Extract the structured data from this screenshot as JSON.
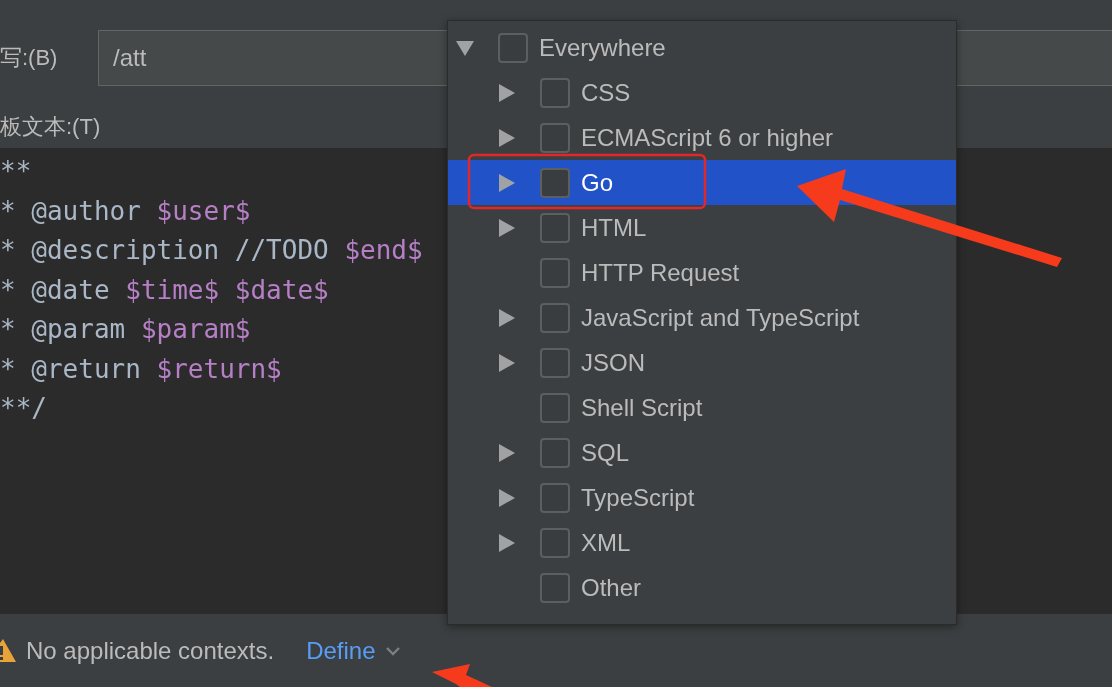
{
  "abbreviation": {
    "label": "写:(B)",
    "value": "/att"
  },
  "template_text": {
    "label": "板文本:(T)",
    "lines": [
      [
        {
          "text": "**",
          "kind": "plain"
        }
      ],
      [
        {
          "text": "* @author ",
          "kind": "plain"
        },
        {
          "text": "$user$",
          "kind": "variable"
        }
      ],
      [
        {
          "text": "* @description //TODO ",
          "kind": "plain"
        },
        {
          "text": "$end$",
          "kind": "variable"
        }
      ],
      [
        {
          "text": "* @date ",
          "kind": "plain"
        },
        {
          "text": "$time$ $date$",
          "kind": "variable"
        }
      ],
      [
        {
          "text": "* @param ",
          "kind": "plain"
        },
        {
          "text": "$param$",
          "kind": "variable"
        }
      ],
      [
        {
          "text": "* @return ",
          "kind": "plain"
        },
        {
          "text": "$return$",
          "kind": "variable"
        }
      ],
      [
        {
          "text": "**/",
          "kind": "plain"
        }
      ]
    ]
  },
  "context_popup": {
    "tree": [
      {
        "label": "Everywhere",
        "expanded": true,
        "checked": false,
        "selected": false,
        "children": [
          {
            "label": "CSS",
            "expanded": false,
            "checked": false,
            "selected": false
          },
          {
            "label": "ECMAScript 6 or higher",
            "expanded": false,
            "checked": false,
            "selected": false
          },
          {
            "label": "Go",
            "expanded": false,
            "checked": false,
            "selected": true
          },
          {
            "label": "HTML",
            "expanded": false,
            "checked": false,
            "selected": false
          },
          {
            "label": "HTTP Request",
            "checked": false,
            "selected": false
          },
          {
            "label": "JavaScript and TypeScript",
            "expanded": false,
            "checked": false,
            "selected": false
          },
          {
            "label": "JSON",
            "expanded": false,
            "checked": false,
            "selected": false
          },
          {
            "label": "Shell Script",
            "checked": false,
            "selected": false
          },
          {
            "label": "SQL",
            "expanded": false,
            "checked": false,
            "selected": false
          },
          {
            "label": "TypeScript",
            "expanded": false,
            "checked": false,
            "selected": false
          },
          {
            "label": "XML",
            "expanded": false,
            "checked": false,
            "selected": false
          },
          {
            "label": "Other",
            "checked": false,
            "selected": false
          }
        ]
      }
    ]
  },
  "status": {
    "message": "No applicable contexts.",
    "link": "Define"
  },
  "annotations": [
    {
      "kind": "highlight-box"
    },
    {
      "kind": "arrow"
    },
    {
      "kind": "arrow-bottom"
    }
  ]
}
